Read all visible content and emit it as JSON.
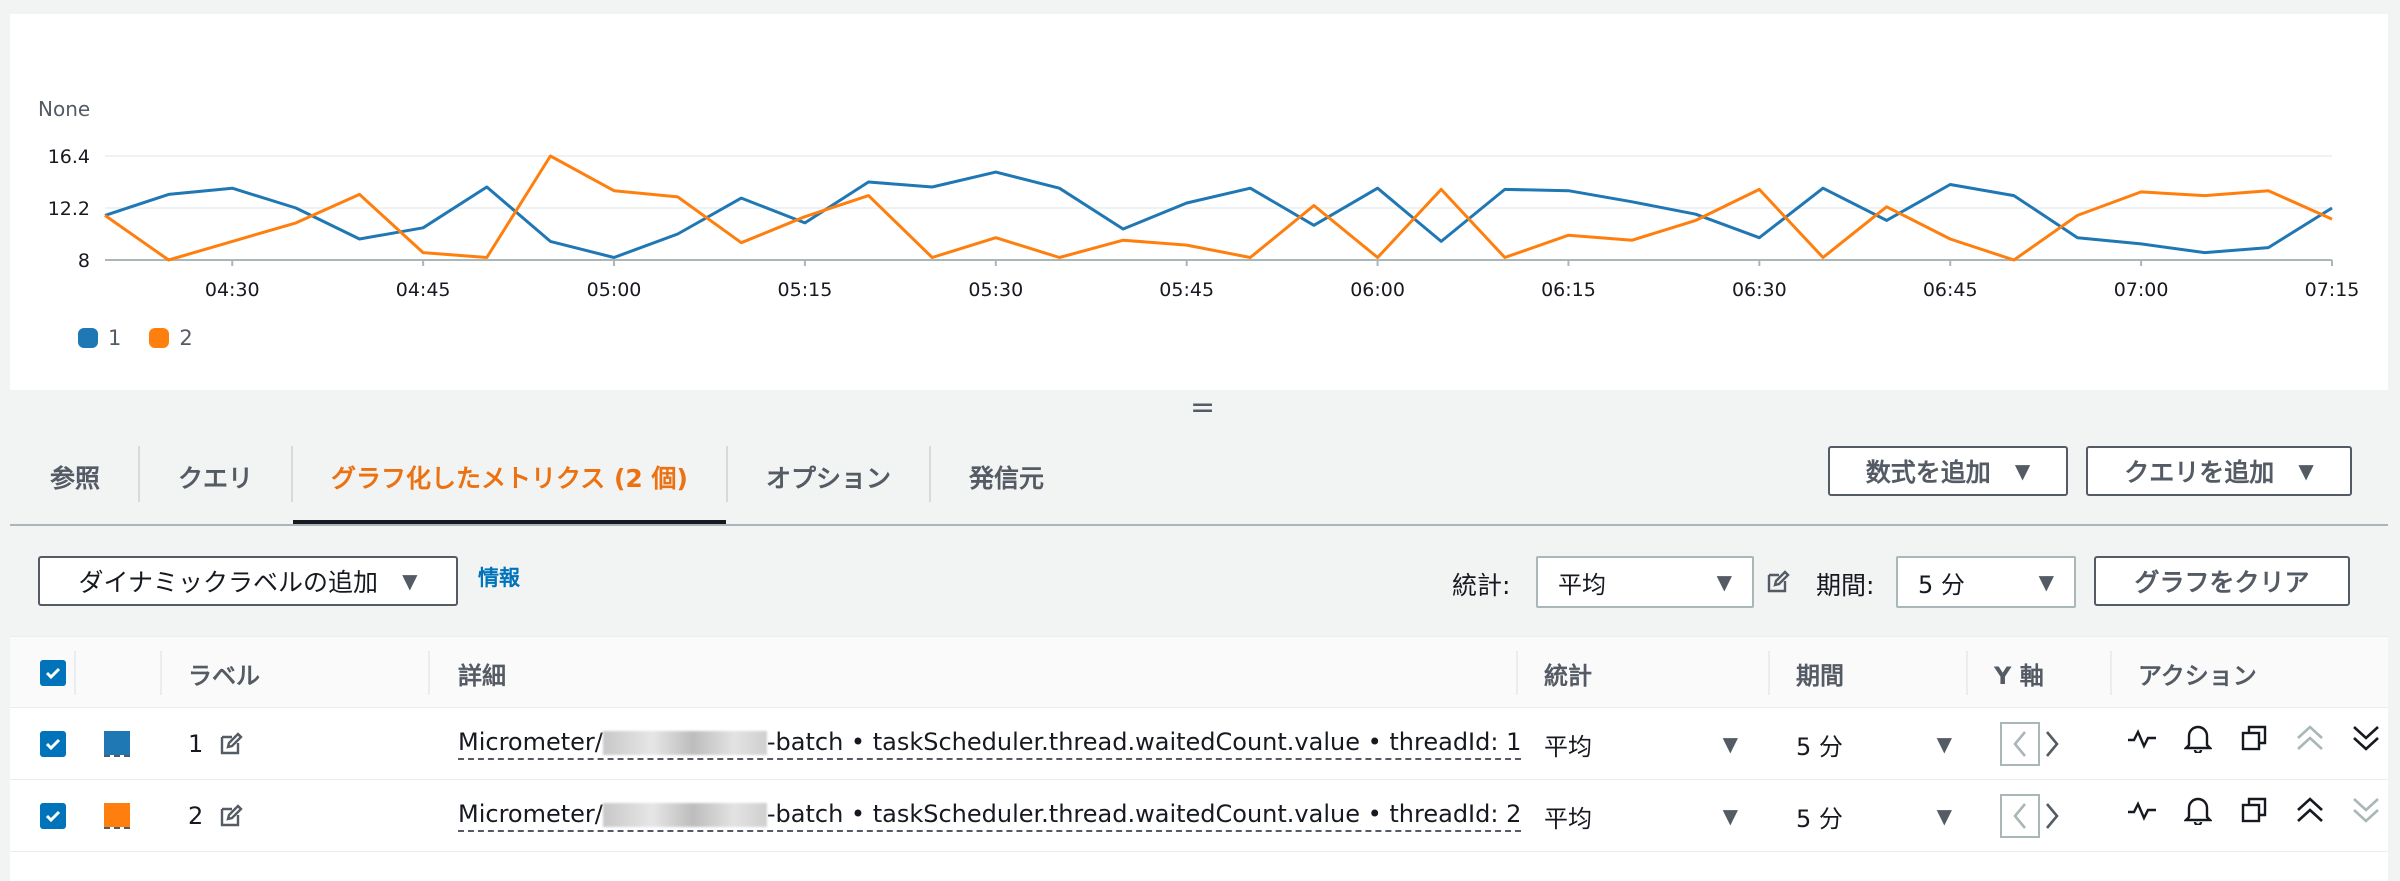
{
  "chart_data": {
    "type": "line",
    "ylabel": "None",
    "y_ticks": [
      "16.4",
      "12.2",
      "8"
    ],
    "ylim": [
      8,
      16.4
    ],
    "x_ticks": [
      "04:30",
      "04:45",
      "05:00",
      "05:15",
      "05:30",
      "05:45",
      "06:00",
      "06:15",
      "06:30",
      "06:45",
      "07:00",
      "07:15"
    ],
    "grid": true,
    "legend_position": "bottom-left",
    "series": [
      {
        "name": "1",
        "color": "#1f77b4",
        "points": [
          [
            "04:20",
            11.6
          ],
          [
            "04:25",
            13.3
          ],
          [
            "04:30",
            13.8
          ],
          [
            "04:35",
            12.2
          ],
          [
            "04:40",
            9.7
          ],
          [
            "04:45",
            10.6
          ],
          [
            "04:50",
            13.9
          ],
          [
            "04:55",
            9.5
          ],
          [
            "05:00",
            8.2
          ],
          [
            "05:05",
            10.1
          ],
          [
            "05:10",
            13.0
          ],
          [
            "05:15",
            11.0
          ],
          [
            "05:20",
            14.3
          ],
          [
            "05:25",
            13.9
          ],
          [
            "05:30",
            15.1
          ],
          [
            "05:35",
            13.8
          ],
          [
            "05:40",
            10.5
          ],
          [
            "05:45",
            12.6
          ],
          [
            "05:50",
            13.8
          ],
          [
            "05:55",
            10.8
          ],
          [
            "06:00",
            13.8
          ],
          [
            "06:05",
            9.5
          ],
          [
            "06:10",
            13.7
          ],
          [
            "06:15",
            13.6
          ],
          [
            "06:20",
            12.7
          ],
          [
            "06:25",
            11.7
          ],
          [
            "06:30",
            9.8
          ],
          [
            "06:35",
            13.8
          ],
          [
            "06:40",
            11.2
          ],
          [
            "06:45",
            14.1
          ],
          [
            "06:50",
            13.2
          ],
          [
            "06:55",
            9.8
          ],
          [
            "07:00",
            9.3
          ],
          [
            "07:05",
            8.6
          ],
          [
            "07:10",
            9.0
          ],
          [
            "07:15",
            12.2
          ]
        ]
      },
      {
        "name": "2",
        "color": "#ff7f0e",
        "points": [
          [
            "04:20",
            11.6
          ],
          [
            "04:25",
            8.0
          ],
          [
            "04:30",
            9.5
          ],
          [
            "04:35",
            11.0
          ],
          [
            "04:40",
            13.3
          ],
          [
            "04:45",
            8.6
          ],
          [
            "04:50",
            8.2
          ],
          [
            "04:55",
            16.4
          ],
          [
            "05:00",
            13.6
          ],
          [
            "05:05",
            13.1
          ],
          [
            "05:10",
            9.4
          ],
          [
            "05:15",
            11.5
          ],
          [
            "05:20",
            13.2
          ],
          [
            "05:25",
            8.2
          ],
          [
            "05:30",
            9.8
          ],
          [
            "05:35",
            8.2
          ],
          [
            "05:40",
            9.6
          ],
          [
            "05:45",
            9.2
          ],
          [
            "05:50",
            8.2
          ],
          [
            "05:55",
            12.4
          ],
          [
            "06:00",
            8.2
          ],
          [
            "06:05",
            13.7
          ],
          [
            "06:10",
            8.2
          ],
          [
            "06:15",
            10.0
          ],
          [
            "06:20",
            9.6
          ],
          [
            "06:25",
            11.2
          ],
          [
            "06:30",
            13.7
          ],
          [
            "06:35",
            8.2
          ],
          [
            "06:40",
            12.3
          ],
          [
            "06:45",
            9.7
          ],
          [
            "06:50",
            8.0
          ],
          [
            "06:55",
            11.6
          ],
          [
            "07:00",
            13.5
          ],
          [
            "07:05",
            13.2
          ],
          [
            "07:10",
            13.6
          ],
          [
            "07:15",
            11.3
          ]
        ]
      }
    ]
  },
  "tabs": [
    {
      "label": "参照"
    },
    {
      "label": "クエリ"
    },
    {
      "label": "グラフ化したメトリクス (2 個)",
      "active": true
    },
    {
      "label": "オプション"
    },
    {
      "label": "発信元"
    }
  ],
  "buttons": {
    "add_math": "数式を追加",
    "add_query": "クエリを追加",
    "add_dynamic_label": "ダイナミックラベルの追加",
    "clear_graph": "グラフをクリア"
  },
  "info_link": "情報",
  "controls": {
    "stat_label": "統計:",
    "stat_value": "平均",
    "period_label": "期間:",
    "period_value": "5 分"
  },
  "table": {
    "headers": {
      "label": "ラベル",
      "details": "詳細",
      "stat": "統計",
      "period": "期間",
      "yaxis": "Y 軸",
      "actions": "アクション"
    },
    "rows": [
      {
        "color": "#1f77b4",
        "label": "1",
        "detail_prefix": "Micrometer/",
        "detail_suffix": "-batch • taskScheduler.thread.waitedCount.value • threadId: 1",
        "stat": "平均",
        "period": "5 分"
      },
      {
        "color": "#ff7f0e",
        "label": "2",
        "detail_prefix": "Micrometer/",
        "detail_suffix": "-batch • taskScheduler.thread.waitedCount.value • threadId: 2",
        "stat": "平均",
        "period": "5 分"
      }
    ]
  },
  "resize_handle": "="
}
